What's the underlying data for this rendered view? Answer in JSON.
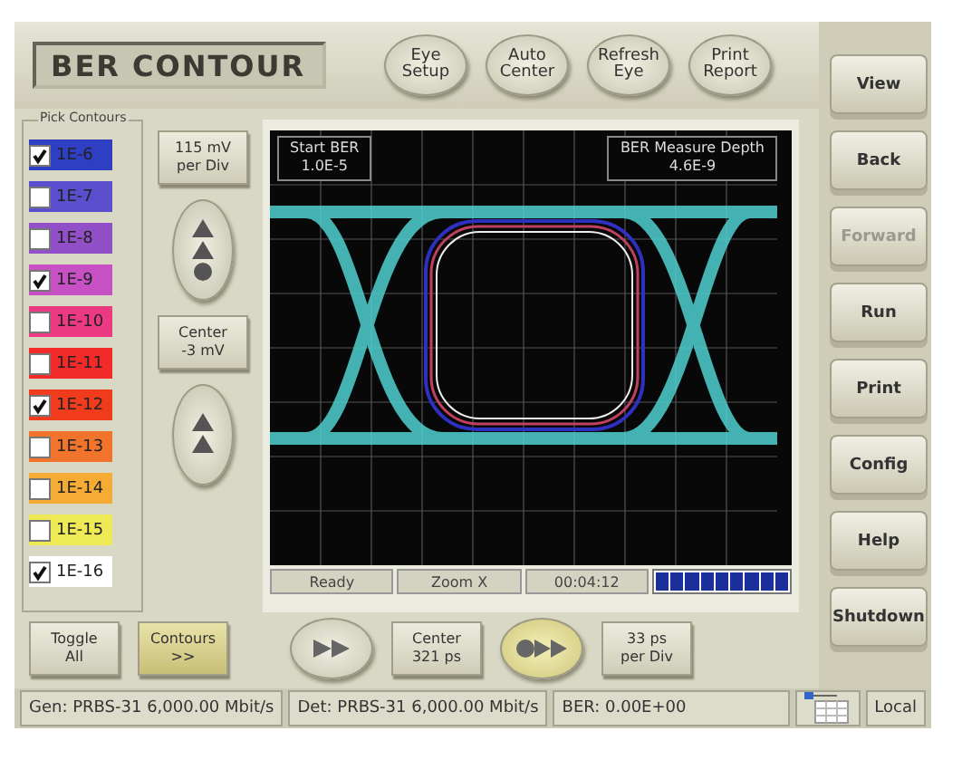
{
  "title": "BER CONTOUR",
  "top_buttons": [
    {
      "label": "Eye\nSetup"
    },
    {
      "label": "Auto\nCenter"
    },
    {
      "label": "Refresh\nEye"
    },
    {
      "label": "Print\nReport"
    }
  ],
  "contours": {
    "title": "Pick Contours",
    "items": [
      {
        "label": "1E-6",
        "checked": true,
        "color": "#2f3fc4"
      },
      {
        "label": "1E-7",
        "checked": false,
        "color": "#5b4fd0"
      },
      {
        "label": "1E-8",
        "checked": false,
        "color": "#9250c8"
      },
      {
        "label": "1E-9",
        "checked": true,
        "color": "#c650c4"
      },
      {
        "label": "1E-10",
        "checked": false,
        "color": "#ec3a82"
      },
      {
        "label": "1E-11",
        "checked": false,
        "color": "#f22a2a"
      },
      {
        "label": "1E-12",
        "checked": true,
        "color": "#f03c1c"
      },
      {
        "label": "1E-13",
        "checked": false,
        "color": "#f2742c"
      },
      {
        "label": "1E-14",
        "checked": false,
        "color": "#f5ac34"
      },
      {
        "label": "1E-15",
        "checked": false,
        "color": "#eeea56"
      },
      {
        "label": "1E-16",
        "checked": true,
        "color": "#ffffff"
      }
    ]
  },
  "vertical": {
    "scale": "115 mV\nper Div",
    "center": "Center\n-3 mV"
  },
  "scope": {
    "start_label": "Start BER",
    "start_value": "1.0E-5",
    "depth_label": "BER Measure Depth",
    "depth_value": "4.6E-9",
    "status": [
      "Ready",
      "Zoom X",
      "00:04:12"
    ],
    "progress": {
      "level": 1
    }
  },
  "bottom": {
    "toggle": "Toggle\nAll",
    "contours": {
      "label": "Contours\n>>",
      "highlighted": true
    },
    "center": "Center\n321 ps",
    "scale": "33 ps\nper Div",
    "step_highlighted": false,
    "run_highlighted": true
  },
  "side_buttons": [
    {
      "label": "View",
      "disabled": false
    },
    {
      "label": "Back",
      "disabled": false
    },
    {
      "label": "Forward",
      "disabled": true
    },
    {
      "label": "Run",
      "disabled": false
    },
    {
      "label": "Print",
      "disabled": false
    },
    {
      "label": "Config",
      "disabled": false
    },
    {
      "label": "Help",
      "disabled": false
    },
    {
      "label": "Shutdown",
      "disabled": false
    }
  ],
  "status_bar": {
    "gen": "Gen: PRBS-31 6,000.00 Mbit/s",
    "det": "Det: PRBS-31 6,000.00 Mbit/s",
    "ber": "BER: 0.00E+00",
    "mode": "Local"
  }
}
